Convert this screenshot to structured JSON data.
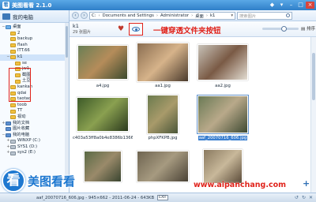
{
  "window": {
    "title": "美图看看 2.1.0",
    "icon_label": "看"
  },
  "sidebar": {
    "header": "我的电脑",
    "items": [
      {
        "label": "桌面",
        "indent": 0,
        "toggle": "−",
        "icon": "desktop-icon"
      },
      {
        "label": "2",
        "indent": 1,
        "toggle": "",
        "icon": "folder-icon"
      },
      {
        "label": "backup",
        "indent": 1,
        "toggle": "",
        "icon": "folder-icon"
      },
      {
        "label": "flash",
        "indent": 1,
        "toggle": "",
        "icon": "folder-icon"
      },
      {
        "label": "ITT.66",
        "indent": 1,
        "toggle": "",
        "icon": "folder-icon"
      },
      {
        "label": "k1",
        "indent": 1,
        "toggle": "−",
        "icon": "folder-icon",
        "selected": true
      },
      {
        "label": "se",
        "indent": 2,
        "toggle": "",
        "icon": "folder-icon"
      },
      {
        "label": "jw1",
        "indent": 2,
        "toggle": "",
        "icon": "folder-icon"
      },
      {
        "label": "截图",
        "indent": 2,
        "toggle": "",
        "icon": "folder-icon"
      },
      {
        "label": "土豆",
        "indent": 2,
        "toggle": "",
        "icon": "folder-icon"
      },
      {
        "label": "kankan",
        "indent": 1,
        "toggle": "",
        "icon": "folder-icon"
      },
      {
        "label": "qdai",
        "indent": 1,
        "toggle": "",
        "icon": "folder-icon"
      },
      {
        "label": "taotao",
        "indent": 1,
        "toggle": "",
        "icon": "folder-icon"
      },
      {
        "label": "toob",
        "indent": 1,
        "toggle": "",
        "icon": "folder-icon"
      },
      {
        "label": "TT",
        "indent": 1,
        "toggle": "",
        "icon": "folder-icon"
      },
      {
        "label": "视动",
        "indent": 1,
        "toggle": "",
        "icon": "folder-icon"
      },
      {
        "label": "我的文档",
        "indent": 0,
        "toggle": "+",
        "icon": "blue-folder-icon"
      },
      {
        "label": "图片收藏",
        "indent": 0,
        "toggle": "",
        "icon": "blue-folder-icon"
      },
      {
        "label": "我的电脑",
        "indent": 0,
        "toggle": "−",
        "icon": "blue-folder-icon"
      },
      {
        "label": "WINXP (C:)",
        "indent": 1,
        "toggle": "+",
        "icon": "drive-icon"
      },
      {
        "label": "SYS1 (D:)",
        "indent": 1,
        "toggle": "+",
        "icon": "drive-icon"
      },
      {
        "label": "sys2 (E:)",
        "indent": 1,
        "toggle": "+",
        "icon": "drive-icon"
      }
    ]
  },
  "address": {
    "drive": "C:",
    "crumbs": [
      "Documents and Settings",
      "Administrator",
      "桌面",
      "k1"
    ],
    "search_placeholder": "搜索图片"
  },
  "toolbar": {
    "folder_name": "k1",
    "folder_meta": "29 张图片",
    "annotation": "一键穿透文件夹按钮",
    "sort_label": "排序"
  },
  "images": [
    {
      "caption": "a4.jpg",
      "col": 0,
      "row": 0,
      "w": 64,
      "h": 44,
      "colors": [
        "#6a7f55",
        "#b58c5a",
        "#3c4a2e"
      ]
    },
    {
      "caption": "aa1.jpg",
      "col": 1,
      "row": 0,
      "w": 66,
      "h": 50,
      "colors": [
        "#8a6d50",
        "#d6b38a",
        "#4a3a2c"
      ]
    },
    {
      "caption": "aa2.jpg",
      "col": 2,
      "row": 0,
      "w": 64,
      "h": 46,
      "colors": [
        "#c7c2b8",
        "#7a5a45",
        "#e3ddd2"
      ]
    },
    {
      "caption": "c403a53ff8a0b4e8386b1366...",
      "col": 0,
      "row": 1,
      "w": 66,
      "h": 44,
      "colors": [
        "#3d5a28",
        "#8aa050",
        "#2b3a1d"
      ]
    },
    {
      "caption": "phpXFKPB.jpg",
      "col": 1,
      "row": 1,
      "w": 40,
      "h": 50,
      "colors": [
        "#6b7b4e",
        "#a89a6a",
        "#4a5638"
      ]
    },
    {
      "caption": "aaf_20070716_606.jpg",
      "col": 2,
      "row": 1,
      "w": 64,
      "h": 48,
      "colors": [
        "#6a7a55",
        "#b9a98a",
        "#3e4a32"
      ],
      "selected": true
    },
    {
      "caption": "",
      "col": 0,
      "row": 2,
      "w": 48,
      "h": 40,
      "colors": [
        "#5a6a45",
        "#9a8a6a",
        "#3a4530"
      ]
    },
    {
      "caption": "",
      "col": 1,
      "row": 2,
      "w": 66,
      "h": 40,
      "colors": [
        "#6e6450",
        "#a69a80",
        "#4a4235"
      ]
    },
    {
      "caption": "",
      "col": 2,
      "row": 2,
      "w": 50,
      "h": 44,
      "colors": [
        "#8a7a60",
        "#c8b89a",
        "#5a4a38"
      ]
    }
  ],
  "status": {
    "text": "aaf_20070716_606.jpg - 945×662 - 2011-06-24 - 643KB",
    "exif": "EXIF"
  },
  "watermark": {
    "logo_char": "看",
    "logo_name": "美图看看",
    "url": "www.aipanchang.com"
  }
}
